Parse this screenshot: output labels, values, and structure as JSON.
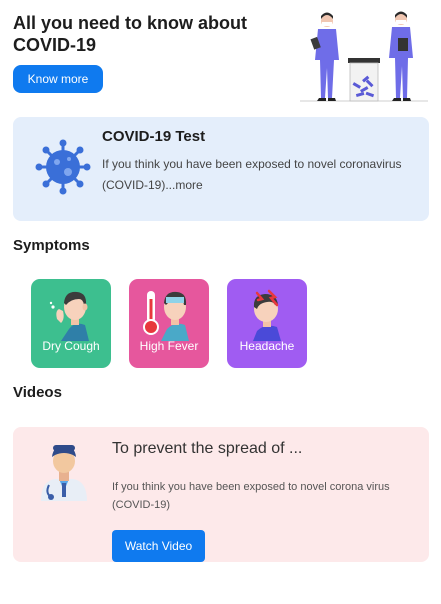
{
  "hero": {
    "title": "All you need to know about COVID-19",
    "button_label": "Know more"
  },
  "test_card": {
    "title": "COVID-19 Test",
    "description": "If you think you have been exposed to novel coronavirus (COVID-19)...",
    "more_label": "more"
  },
  "symptoms": {
    "heading": "Symptoms",
    "items": [
      {
        "label": "Dry Cough",
        "color": "#3dbf8f",
        "icon": "coughing-person-icon"
      },
      {
        "label": "High Fever",
        "color": "#e6579d",
        "icon": "thermometer-fever-icon"
      },
      {
        "label": "Headache",
        "color": "#a05cf2",
        "icon": "headache-person-icon"
      }
    ]
  },
  "videos": {
    "heading": "Videos",
    "items": [
      {
        "title": "To prevent the spread of ...",
        "description": "If you think you have been exposed to novel corona virus (COVID-19)",
        "button_label": "Watch Video",
        "icon": "doctor-icon"
      }
    ]
  },
  "colors": {
    "accent": "#0f7aef",
    "test_card_bg": "#e4eefb",
    "video_card_bg": "#fde9ea"
  }
}
